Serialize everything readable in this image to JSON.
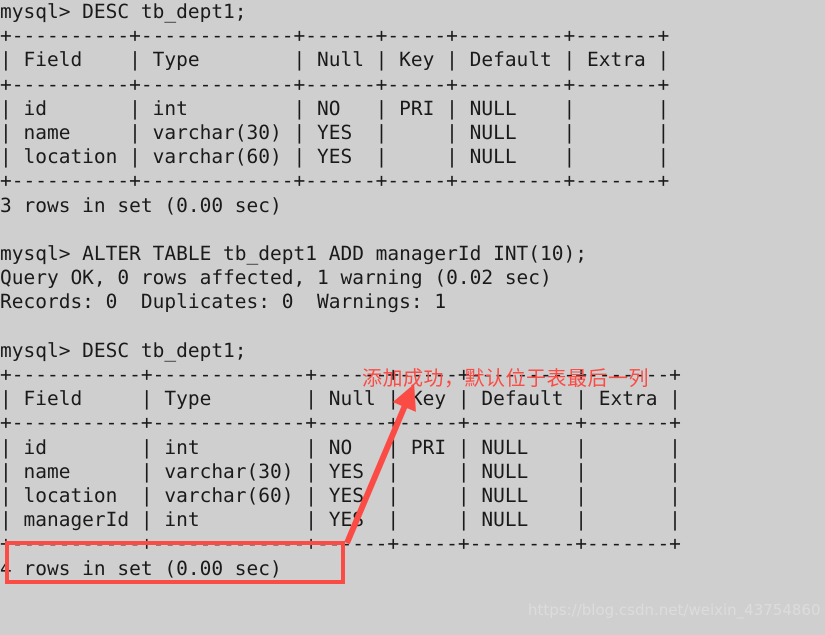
{
  "terminal": {
    "background_color": "#cfcfcf",
    "text_color": "#1a1a1a",
    "prompt": "mysql>",
    "lines": [
      "mysql> DESC tb_dept1;",
      "+----------+-------------+------+-----+---------+-------+",
      "| Field    | Type        | Null | Key | Default | Extra |",
      "+----------+-------------+------+-----+---------+-------+",
      "| id       | int         | NO   | PRI | NULL    |       |",
      "| name     | varchar(30) | YES  |     | NULL    |       |",
      "| location | varchar(60) | YES  |     | NULL    |       |",
      "+----------+-------------+------+-----+---------+-------+",
      "3 rows in set (0.00 sec)",
      "",
      "mysql> ALTER TABLE tb_dept1 ADD managerId INT(10);",
      "Query OK, 0 rows affected, 1 warning (0.02 sec)",
      "Records: 0  Duplicates: 0  Warnings: 1",
      "",
      "mysql> DESC tb_dept1;",
      "+-----------+-------------+------+-----+---------+-------+",
      "| Field     | Type        | Null | Key | Default | Extra |",
      "+-----------+-------------+------+-----+---------+-------+",
      "| id        | int         | NO   | PRI | NULL    |       |",
      "| name      | varchar(30) | YES  |     | NULL    |       |",
      "| location  | varchar(60) | YES  |     | NULL    |       |",
      "| managerId | int         | YES  |     | NULL    |       |",
      "+-----------+-------------+------+-----+---------+-------+",
      "4 rows in set (0.00 sec)"
    ],
    "commands": [
      "DESC tb_dept1;",
      "ALTER TABLE tb_dept1 ADD managerId INT(10);",
      "DESC tb_dept1;"
    ],
    "result_table_1": {
      "headers": [
        "Field",
        "Type",
        "Null",
        "Key",
        "Default",
        "Extra"
      ],
      "rows": [
        [
          "id",
          "int",
          "NO",
          "PRI",
          "NULL",
          ""
        ],
        [
          "name",
          "varchar(30)",
          "YES",
          "",
          "NULL",
          ""
        ],
        [
          "location",
          "varchar(60)",
          "YES",
          "",
          "NULL",
          ""
        ]
      ],
      "footer": "3 rows in set (0.00 sec)"
    },
    "alter_output": {
      "status": "Query OK, 0 rows affected, 1 warning (0.02 sec)",
      "records": "Records: 0  Duplicates: 0  Warnings: 1"
    },
    "result_table_2": {
      "headers": [
        "Field",
        "Type",
        "Null",
        "Key",
        "Default",
        "Extra"
      ],
      "rows": [
        [
          "id",
          "int",
          "NO",
          "PRI",
          "NULL",
          ""
        ],
        [
          "name",
          "varchar(30)",
          "YES",
          "",
          "NULL",
          ""
        ],
        [
          "location",
          "varchar(60)",
          "YES",
          "",
          "NULL",
          ""
        ],
        [
          "managerId",
          "int",
          "YES",
          "",
          "NULL",
          ""
        ]
      ],
      "footer": "4 rows in set (0.00 sec)"
    }
  },
  "annotation": {
    "text": "添加成功，默认位于表最后一列",
    "color": "#fb4b45",
    "highlight_target": "managerId"
  },
  "watermark": {
    "text": "https://blog.csdn.net/weixin_43754860",
    "color": "#dcdcdc"
  }
}
